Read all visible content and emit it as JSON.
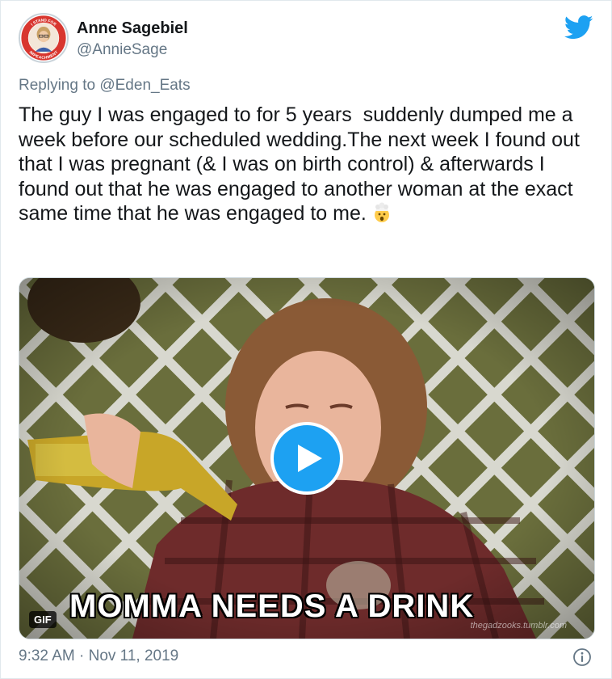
{
  "tweet": {
    "author_name": "Anne Sagebiel",
    "author_handle": "@AnnieSage",
    "avatar_text_top": "I STAND FOR",
    "avatar_text_bottom": "IMPEACHMENT",
    "replying_prefix": "Replying to",
    "replying_to": "@Eden_Eats",
    "text": "The guy I was engaged to for 5 years  suddenly dumped me a week before our scheduled wedding.The next week I found out that I was pregnant (& I was on birth control) & afterwards I found out that he was engaged to another woman at the exact same time that he was engaged to me.",
    "emoji": "exploding-head-emoji",
    "timestamp": "9:32 AM · Nov 11, 2019"
  },
  "media": {
    "type": "gif",
    "badge": "GIF",
    "caption": "MOMMA NEEDS A DRINK",
    "watermark": "thegadzooks.tumblr.com"
  },
  "icons": {
    "brand": "twitter-bird-icon",
    "play": "play-icon",
    "info": "info-icon"
  },
  "colors": {
    "accent": "#1da1f2",
    "secondary_text": "#657786",
    "primary_text": "#14171a"
  }
}
